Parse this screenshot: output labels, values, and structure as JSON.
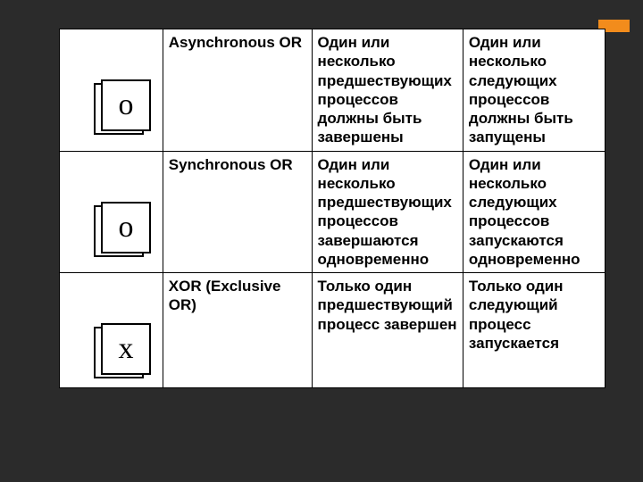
{
  "rows": [
    {
      "letter": "о",
      "name": "Asynchronous OR",
      "col3": "Один или несколько предшествующих процессов должны быть завершены",
      "col4": "Один или несколько следующих процессов должны быть запущены"
    },
    {
      "letter": "о",
      "name": "Synchronous OR",
      "col3": "Один или несколько предшествующих процессов завершаются одновременно",
      "col4": "Один или несколько следующих процессов запускаются одновременно"
    },
    {
      "letter": "х",
      "name": "XOR (Exclusive OR)",
      "col3": "Только один предшествующий процесс завершен",
      "col4": "Только один следующий процесс запускается"
    }
  ]
}
